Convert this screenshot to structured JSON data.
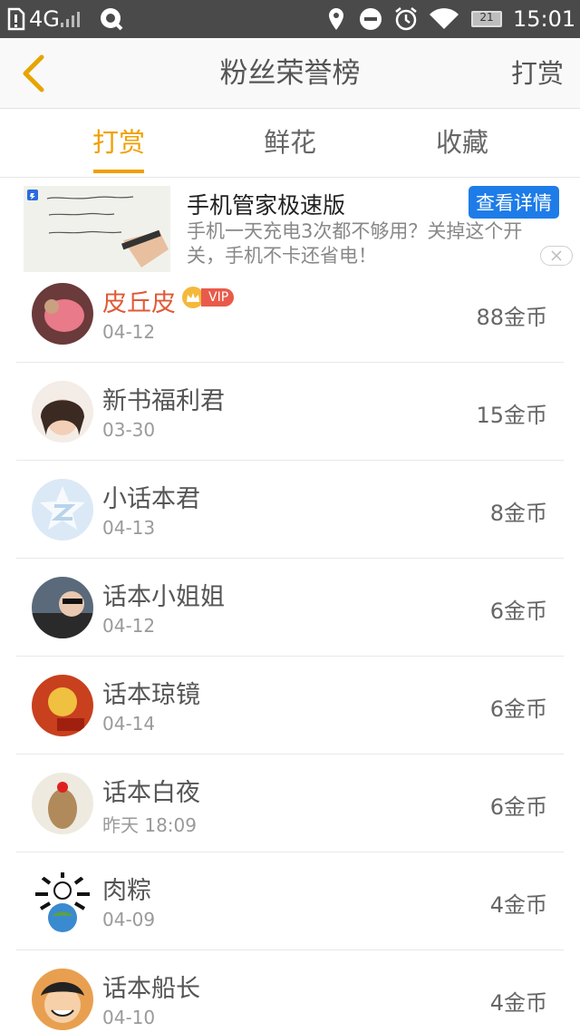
{
  "status_bar": {
    "network": "4G",
    "battery": "21",
    "time": "15:01"
  },
  "header": {
    "title": "粉丝荣誉榜",
    "action": "打赏"
  },
  "tabs": [
    {
      "label": "打赏",
      "active": true
    },
    {
      "label": "鲜花",
      "active": false
    },
    {
      "label": "收藏",
      "active": false
    }
  ],
  "ad": {
    "title": "手机管家极速版",
    "description": "手机一天充电3次都不够用？关掉这个开关，手机不卡还省电！",
    "button": "查看详情"
  },
  "fans": [
    {
      "name": "皮丘皮",
      "date": "04-12",
      "amount": "88金币",
      "vip": "VIP"
    },
    {
      "name": "新书福利君",
      "date": "03-30",
      "amount": "15金币"
    },
    {
      "name": "小话本君",
      "date": "04-13",
      "amount": "8金币"
    },
    {
      "name": "话本小姐姐",
      "date": "04-12",
      "amount": "6金币"
    },
    {
      "name": "话本琼镜",
      "date": "04-14",
      "amount": "6金币"
    },
    {
      "name": "话本白夜",
      "date": "昨天 18:09",
      "amount": "6金币"
    },
    {
      "name": "肉粽",
      "date": "04-09",
      "amount": "4金币"
    },
    {
      "name": "话本船长",
      "date": "04-10",
      "amount": "4金币"
    }
  ],
  "colors": {
    "accent": "#f0a000",
    "top_name": "#e05a36",
    "ad_button": "#1e7ce8"
  }
}
